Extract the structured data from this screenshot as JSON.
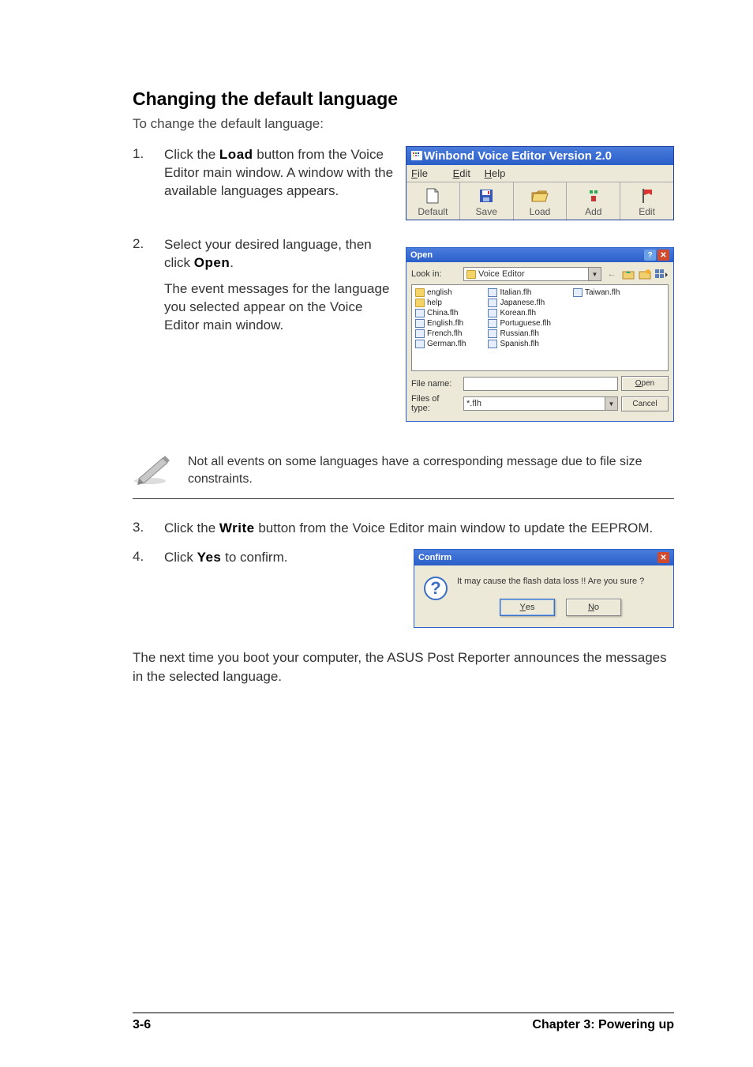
{
  "heading": "Changing the default language",
  "intro": "To change the default language:",
  "steps": {
    "s1": {
      "num": "1.",
      "pre": "Click the ",
      "bold": "Load",
      "post": " button from the Voice Editor main window. A window with the available languages appears."
    },
    "s2": {
      "num": "2.",
      "pre": "Select your desired language, then click ",
      "bold": "Open",
      "post": ".",
      "sub": "The event messages for the language you selected appear on the Voice Editor main window."
    },
    "s3": {
      "num": "3.",
      "pre": "Click the ",
      "bold": "Write",
      "post": " button from the Voice Editor main window to update the EEPROM."
    },
    "s4": {
      "num": "4.",
      "pre": "Click ",
      "bold": "Yes",
      "post": " to confirm."
    }
  },
  "winbond": {
    "title": "Winbond Voice Editor  Version 2.0",
    "menu": {
      "file": "File",
      "edit": "Edit",
      "help": "Help"
    },
    "toolbar": {
      "default": "Default",
      "save": "Save",
      "load": "Load",
      "add": "Add",
      "edit": "Edit"
    }
  },
  "openDlg": {
    "title": "Open",
    "lookin_label": "Look in:",
    "lookin_value": "Voice Editor",
    "files_col1": [
      "english",
      "help",
      "China.flh",
      "English.flh",
      "French.flh",
      "German.flh"
    ],
    "files_col2": [
      "Italian.flh",
      "Japanese.flh",
      "Korean.flh",
      "Portuguese.flh",
      "Russian.flh",
      "Spanish.flh"
    ],
    "files_col3": [
      "Taiwan.flh"
    ],
    "filename_label": "File name:",
    "filetype_label": "Files of type:",
    "filetype_value": "*.flh",
    "open_btn": "Open",
    "cancel_btn": "Cancel"
  },
  "note": "Not all events on some languages have a corresponding message due to file size constraints.",
  "confirm": {
    "title": "Confirm",
    "msg": "It may cause the flash data loss !!  Are you sure ?",
    "yes": "Yes",
    "no": "No"
  },
  "closing": "The next time you boot your computer, the ASUS Post Reporter announces the messages in the selected language.",
  "footer": {
    "left": "3-6",
    "right": "Chapter 3: Powering up"
  }
}
